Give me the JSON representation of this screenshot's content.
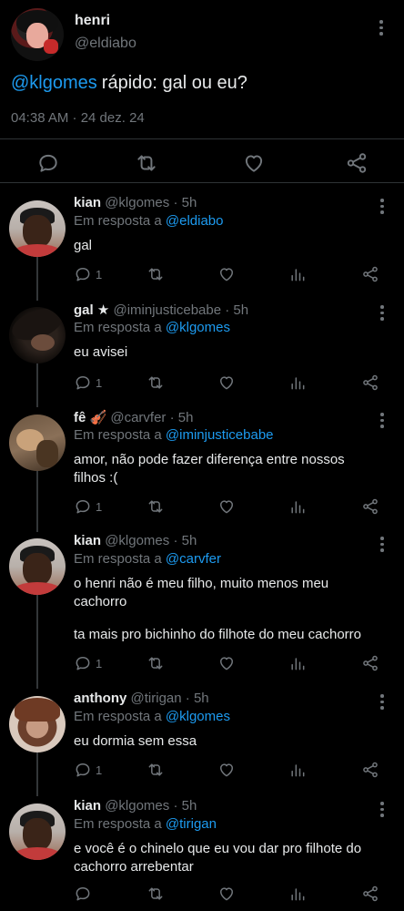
{
  "colors": {
    "background": "#000000",
    "text": "#e7e9ea",
    "muted": "#71767b",
    "link": "#1d9bf0",
    "divider": "#2f3336"
  },
  "main_tweet": {
    "name": "henri",
    "handle": "@eldiabo",
    "mention": "@klgomes",
    "text": "rápido: gal ou eu?",
    "timestamp": "04:38 AM · 24 dez. 24",
    "actions": [
      "reply-icon",
      "retweet-icon",
      "like-icon",
      "share-icon"
    ]
  },
  "replies": [
    {
      "name": "kian",
      "handle": "@klgomes",
      "time": "· 5h",
      "reply_prefix": "Em resposta a",
      "reply_to": "@eldiabo",
      "lines": [
        "gal"
      ],
      "reply_count": "1"
    },
    {
      "name": "gal ★",
      "handle": "@iminjusticebabe",
      "time": "· 5h",
      "reply_prefix": "Em resposta a",
      "reply_to": "@klgomes",
      "lines": [
        "eu avisei"
      ],
      "reply_count": "1"
    },
    {
      "name": "fê 🎻",
      "handle": "@carvfer",
      "time": "· 5h",
      "reply_prefix": "Em resposta a",
      "reply_to": "@iminjusticebabe",
      "lines": [
        "amor, não pode fazer diferença entre nossos",
        "filhos :("
      ],
      "reply_count": "1"
    },
    {
      "name": "kian",
      "handle": "@klgomes",
      "time": "· 5h",
      "reply_prefix": "Em resposta a",
      "reply_to": "@carvfer",
      "lines": [
        "o henri não é meu filho, muito menos meu",
        "cachorro",
        "",
        "ta mais pro bichinho do filhote do meu cachorro"
      ],
      "reply_count": "1"
    },
    {
      "name": "anthony",
      "handle": "@tirigan",
      "time": "· 5h",
      "reply_prefix": "Em resposta a",
      "reply_to": "@klgomes",
      "lines": [
        "eu dormia sem essa"
      ],
      "reply_count": "1"
    },
    {
      "name": "kian",
      "handle": "@klgomes",
      "time": "· 5h",
      "reply_prefix": "Em resposta a",
      "reply_to": "@tirigan",
      "lines": [
        "e você é o chinelo que eu vou dar pro filhote do",
        "cachorro arrebentar"
      ],
      "reply_count": ""
    }
  ]
}
